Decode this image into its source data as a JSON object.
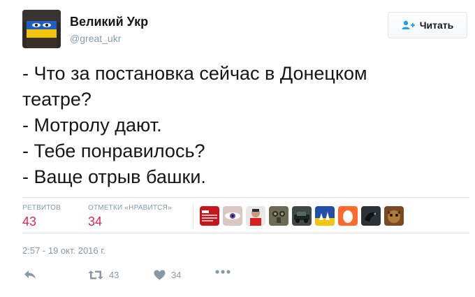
{
  "author": {
    "name": "Великий Укр",
    "handle": "@great_ukr"
  },
  "follow_button": {
    "label": "Читать",
    "icon": "follow-person-plus-icon"
  },
  "tweet": {
    "lines": [
      "- Что за постановка сейчас в Донецком",
      "театре?",
      "- Мотролу дают.",
      "- Тебе понравилось?",
      "- Ваще отрыв башки."
    ]
  },
  "stats": {
    "retweets_label": "РЕТВИТОВ",
    "retweets_count": "43",
    "likes_label": "ОТМЕТКИ «НРАВИТСЯ»",
    "likes_count": "34"
  },
  "liker_avatars": [
    {
      "icon": "liker-avatar-red-logo"
    },
    {
      "icon": "liker-avatar-eye"
    },
    {
      "icon": "liker-avatar-person-red"
    },
    {
      "icon": "liker-avatar-gasmask"
    },
    {
      "icon": "liker-avatar-car"
    },
    {
      "icon": "liker-avatar-flag-blue"
    },
    {
      "icon": "liker-avatar-orange-egg"
    },
    {
      "icon": "liker-avatar-dark-bird"
    },
    {
      "icon": "liker-avatar-animal"
    }
  ],
  "timestamp": "2:57 - 19 окт. 2016 г.",
  "actions": {
    "reply_icon": "reply-icon",
    "retweet_icon": "retweet-icon",
    "retweet_count": "43",
    "like_icon": "heart-icon",
    "like_count": "34",
    "more_icon": "more-dots-icon"
  },
  "colors": {
    "count_red": "#e0245e",
    "muted": "#8899a6",
    "border": "#e1e8ed",
    "follow_icon_blue": "#1da1f2"
  }
}
